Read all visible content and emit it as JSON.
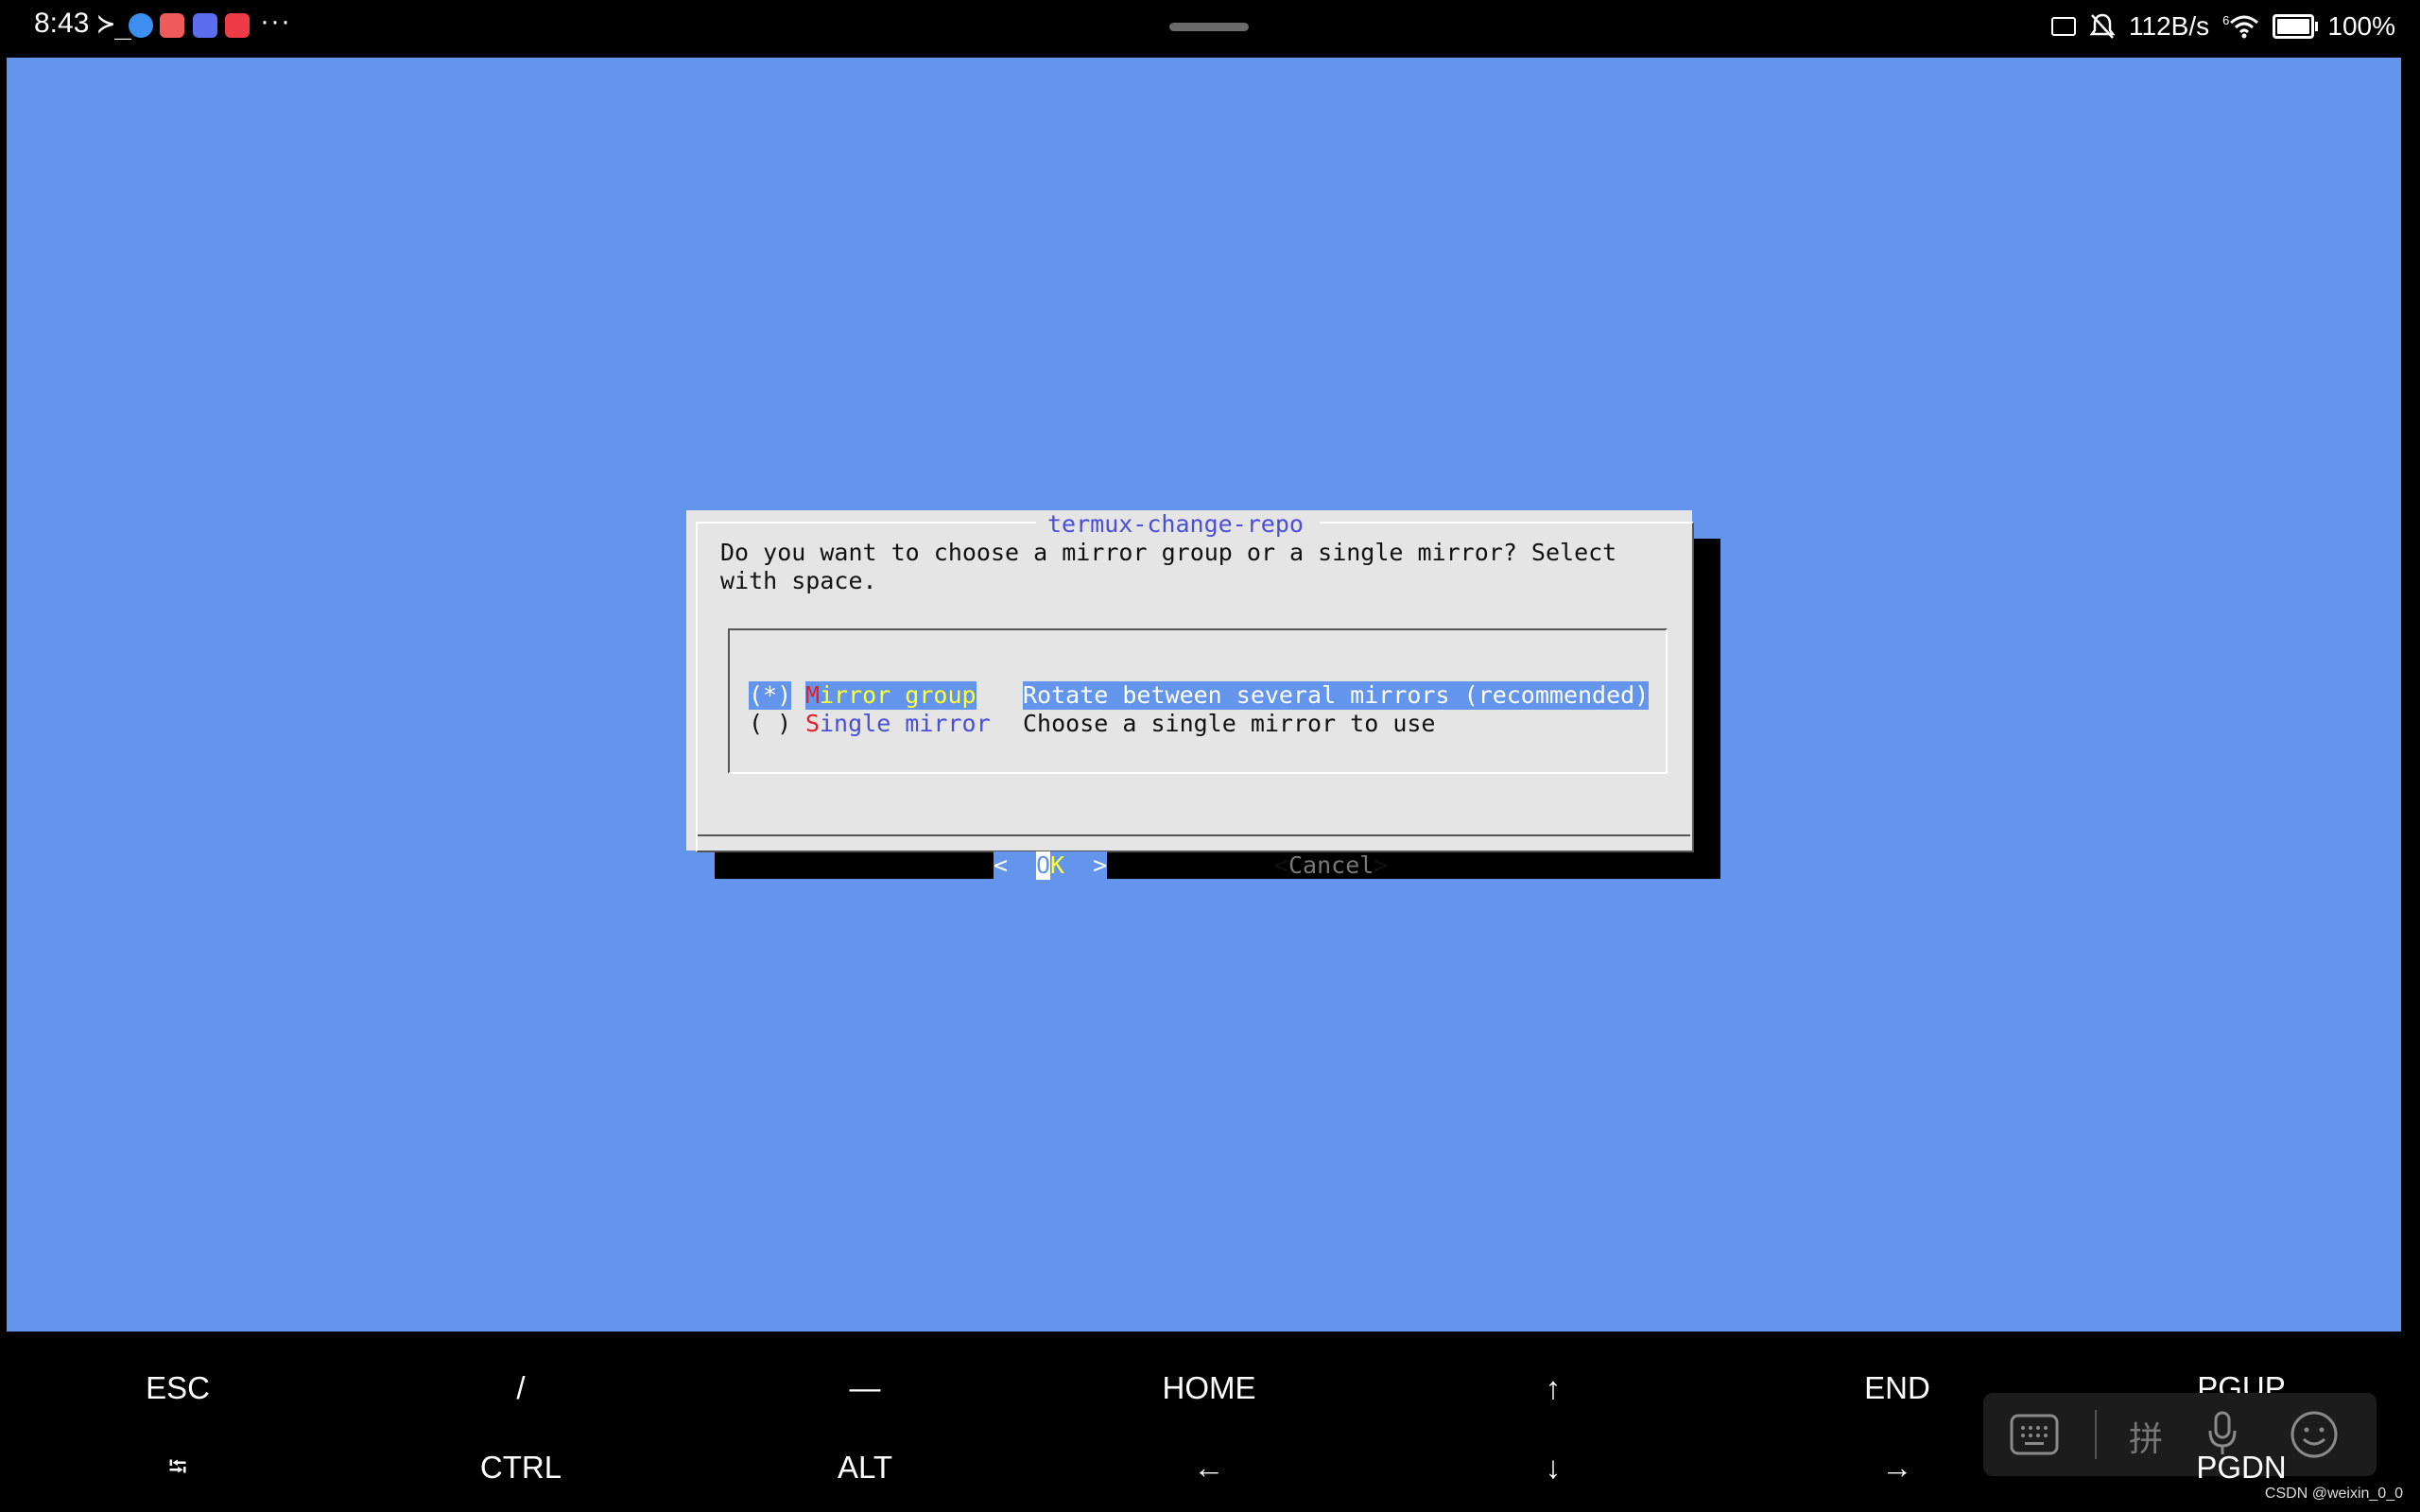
{
  "status_bar": {
    "time": "8:43",
    "terminal_glyph": "≻_",
    "app_icons": [
      {
        "icon": "browser-icon",
        "color": "#3c8ef0"
      },
      {
        "icon": "app-red-icon",
        "color": "#ef5a5a"
      },
      {
        "icon": "music-icon",
        "color": "#5b6ef0"
      },
      {
        "icon": "message-icon",
        "color": "#ef3b47"
      }
    ],
    "more": "···",
    "net_speed": "112B/s",
    "network_badge": "6",
    "battery": "100%"
  },
  "terminal": {
    "background": "#6495ec",
    "dialog": {
      "title": "termux-change-repo",
      "prompt_line1": "Do you want to choose a mirror group or a single mirror? Select",
      "prompt_line2": "with space.",
      "options": [
        {
          "marker": "(*)",
          "hotkey": "M",
          "name_rest": "irror group",
          "description": "Rotate between several mirrors (recommended)",
          "selected": true
        },
        {
          "marker": "( )",
          "hotkey": "S",
          "name_rest": "ingle mirror",
          "description": "Choose a single mirror to use",
          "selected": false
        }
      ],
      "ok_button": {
        "left": "<  ",
        "o": "O",
        "k": "K",
        "right": "  >"
      },
      "cancel_button": {
        "lt": "<",
        "label": "Cancel",
        "gt": ">"
      }
    }
  },
  "extra_keys": {
    "row1": [
      "ESC",
      "/",
      "—",
      "HOME",
      "↑",
      "END",
      "PGUP"
    ],
    "row2": [
      "⭾",
      "CTRL",
      "ALT",
      "←",
      "↓",
      "→",
      "PGDN"
    ]
  },
  "ime_toolbar": {
    "pinyin_char": "拼"
  },
  "watermark": "CSDN @weixin_0_0"
}
